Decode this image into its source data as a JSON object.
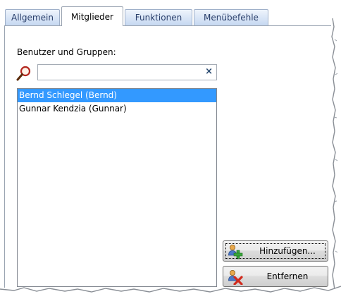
{
  "tabs": [
    {
      "label": "Allgemein",
      "active": false
    },
    {
      "label": "Mitglieder",
      "active": true
    },
    {
      "label": "Funktionen",
      "active": false
    },
    {
      "label": "Menübefehle",
      "active": false
    }
  ],
  "members": {
    "label": "Benutzer und Gruppen:",
    "search_value": "",
    "clear_glyph": "×",
    "items": [
      {
        "text": "Bernd Schlegel (Bernd)",
        "selected": true
      },
      {
        "text": "Gunnar Kendzia (Gunnar)",
        "selected": false
      }
    ],
    "selection_color": "#3399ff"
  },
  "buttons": {
    "add_label": "Hinzufügen...",
    "remove_label": "Entfernen"
  },
  "icons": {
    "search": "magnifier-icon",
    "add": "user-add-icon",
    "remove": "user-remove-icon"
  }
}
